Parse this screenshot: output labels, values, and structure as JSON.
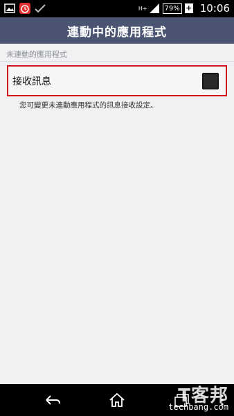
{
  "status_bar": {
    "battery": "79%",
    "charging": "+",
    "network": "H+",
    "time": "10:06",
    "icons": [
      "image-icon",
      "alarm-icon",
      "check-icon",
      "signal-icon",
      "battery-icon"
    ]
  },
  "header": {
    "title": "連動中的應用程式"
  },
  "section": {
    "label": "未連動的應用程式"
  },
  "setting": {
    "label": "接收訊息",
    "checked": true,
    "description": "您可變更未連動應用程式的訊息接收設定。"
  },
  "watermark": {
    "logo": "T客邦",
    "text": "techbang.com"
  },
  "colors": {
    "header_bg": "#4b5571",
    "highlight_border": "#d0121b",
    "page_bg": "#f1f1f3"
  }
}
